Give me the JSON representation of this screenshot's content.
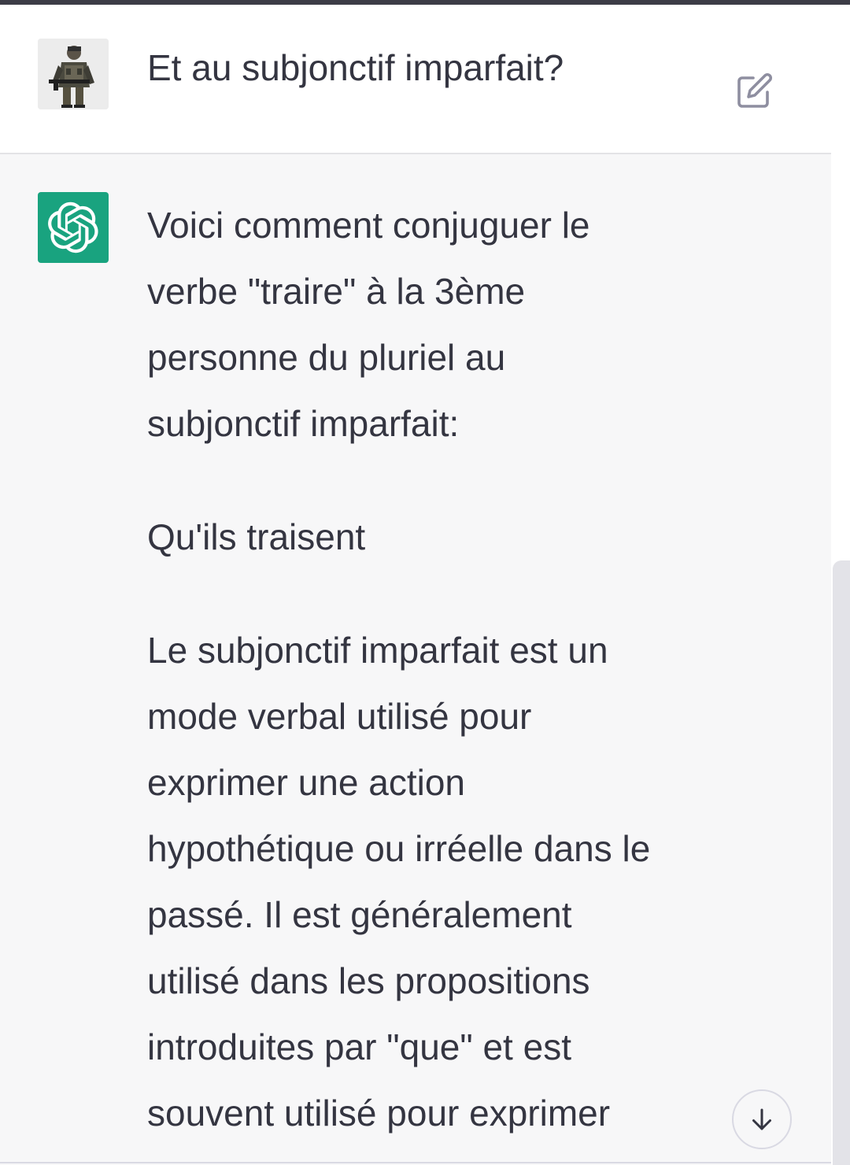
{
  "user_message": {
    "avatar_icon": "user-photo-avatar",
    "text": "Et au subjonctif imparfait?",
    "edit_icon": "edit-icon"
  },
  "assistant_message": {
    "avatar_icon": "openai-logo-icon",
    "avatar_color": "#19a37f",
    "paragraphs": [
      "Voici comment conjuguer le verbe \"traire\" à la 3ème personne du pluriel au subjonctif imparfait:",
      "Qu'ils traisent",
      "Le subjonctif imparfait est un mode verbal utilisé pour exprimer une action hypothétique ou irréelle dans le passé. Il est généralement utilisé dans les propositions introduites par \"que\" et est souvent utilisé pour exprimer"
    ]
  },
  "scroll_down_icon": "arrow-down-icon"
}
